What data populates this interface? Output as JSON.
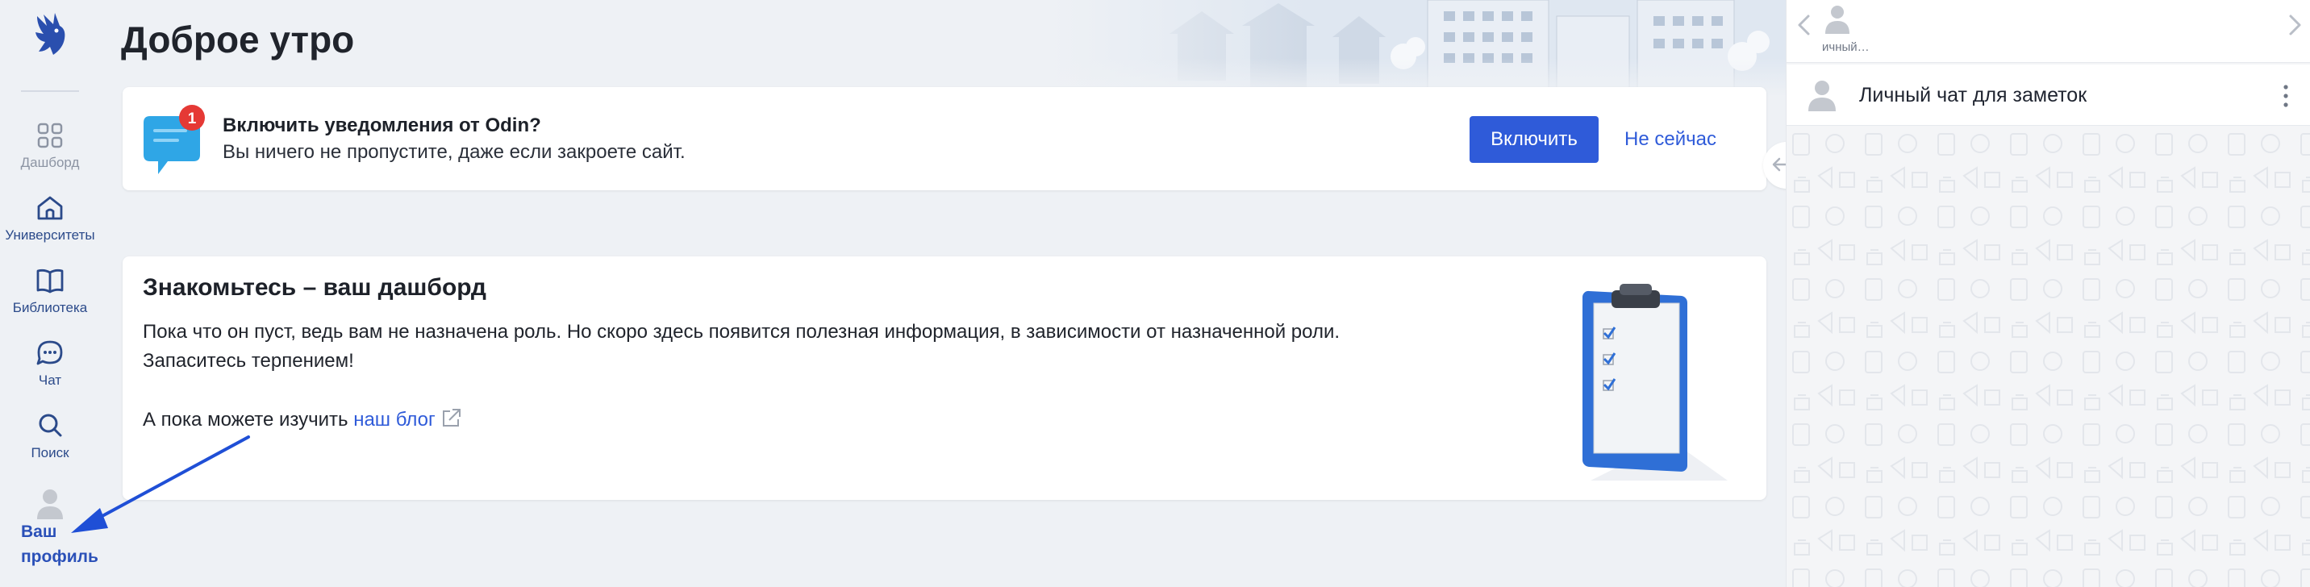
{
  "sidebar": {
    "items": [
      {
        "label": "Дашборд",
        "icon": "grid-icon"
      },
      {
        "label": "Университеты",
        "icon": "home-icon"
      },
      {
        "label": "Библиотека",
        "icon": "book-icon"
      },
      {
        "label": "Чат",
        "icon": "chat-icon"
      },
      {
        "label": "Поиск",
        "icon": "search-icon"
      }
    ],
    "profile_label_1": "Ваш",
    "profile_label_2": "профиль"
  },
  "header": {
    "title": "Доброе утро"
  },
  "notification": {
    "badge": "1",
    "title": "Включить уведомления от Odin?",
    "subtitle": "Вы ничего не пропустите, даже если закроете сайт.",
    "enable_label": "Включить",
    "later_label": "Не сейчас"
  },
  "dashboard": {
    "title": "Знакомьтесь – ваш дашборд",
    "line1": "Пока что он пуст, ведь вам не назначена роль. Но скоро здесь появится полезная информация, в зависимости от назначенной роли.",
    "line2": "Запаситесь терпением!",
    "blog_prefix": "А пока можете изучить ",
    "blog_link": "наш блог"
  },
  "chat_panel": {
    "tab_label": "ичный…",
    "row_name": "Личный чат для заметок"
  },
  "colors": {
    "accent": "#2f5bd9",
    "nav_text": "#2b4a8a",
    "badge": "#e53935",
    "annotation_arrow": "#1f4fd6"
  }
}
